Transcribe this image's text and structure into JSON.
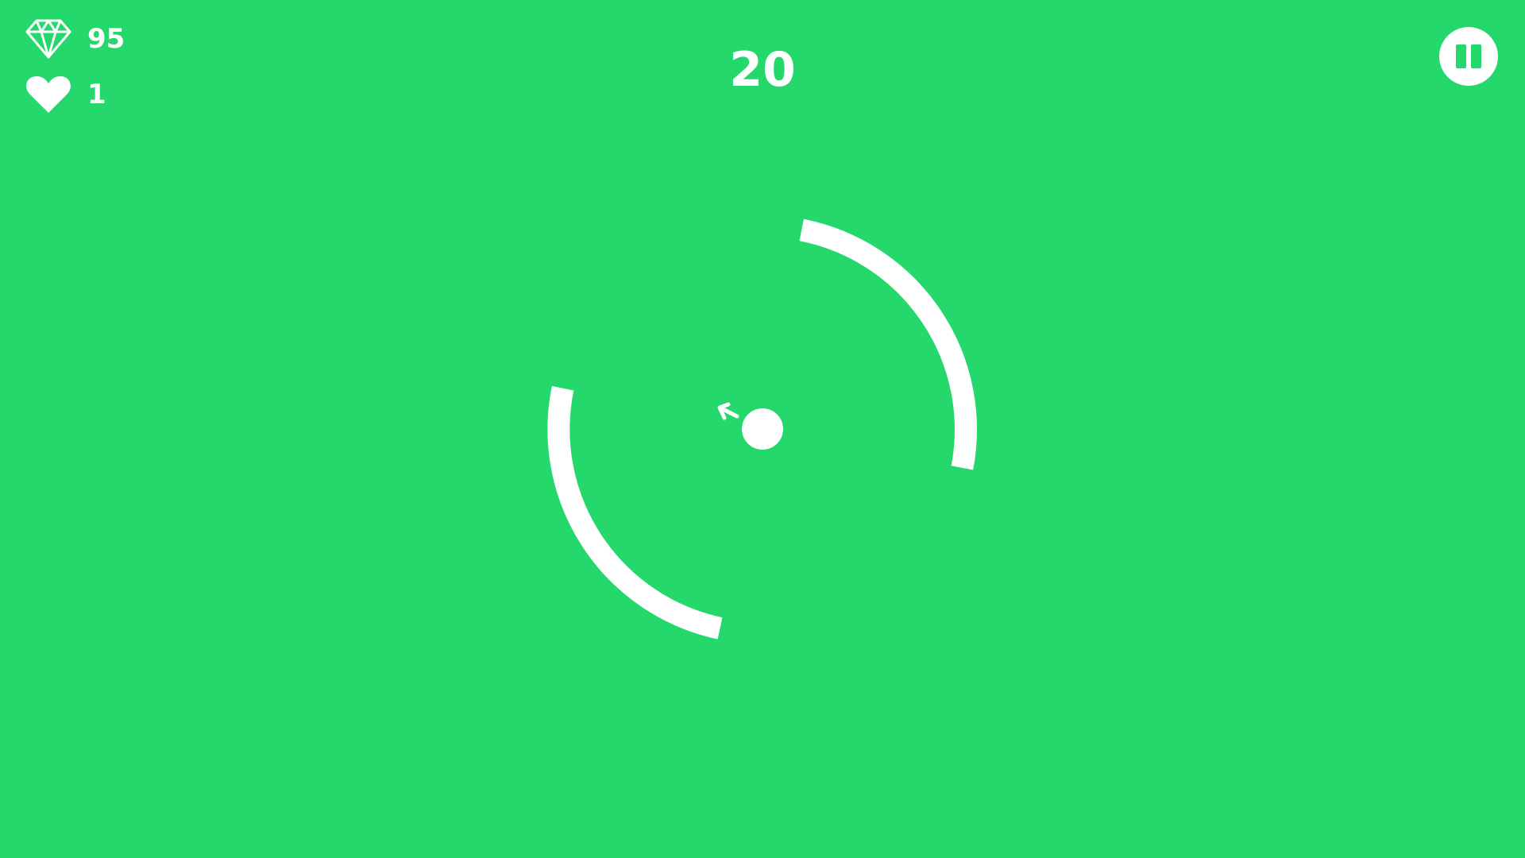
{
  "hud": {
    "gems": {
      "icon": "diamond-icon",
      "value": "95"
    },
    "lives": {
      "icon": "heart-icon",
      "value": "1"
    },
    "score": "20"
  },
  "controls": {
    "pause": {
      "icon": "pause-icon"
    }
  },
  "game": {
    "arc_ring": {
      "segments": 2,
      "color": "#ffffff"
    },
    "ball": {
      "color": "#ffffff",
      "direction": "up-left"
    }
  },
  "colors": {
    "background": "#25D86B",
    "foreground": "#ffffff"
  }
}
